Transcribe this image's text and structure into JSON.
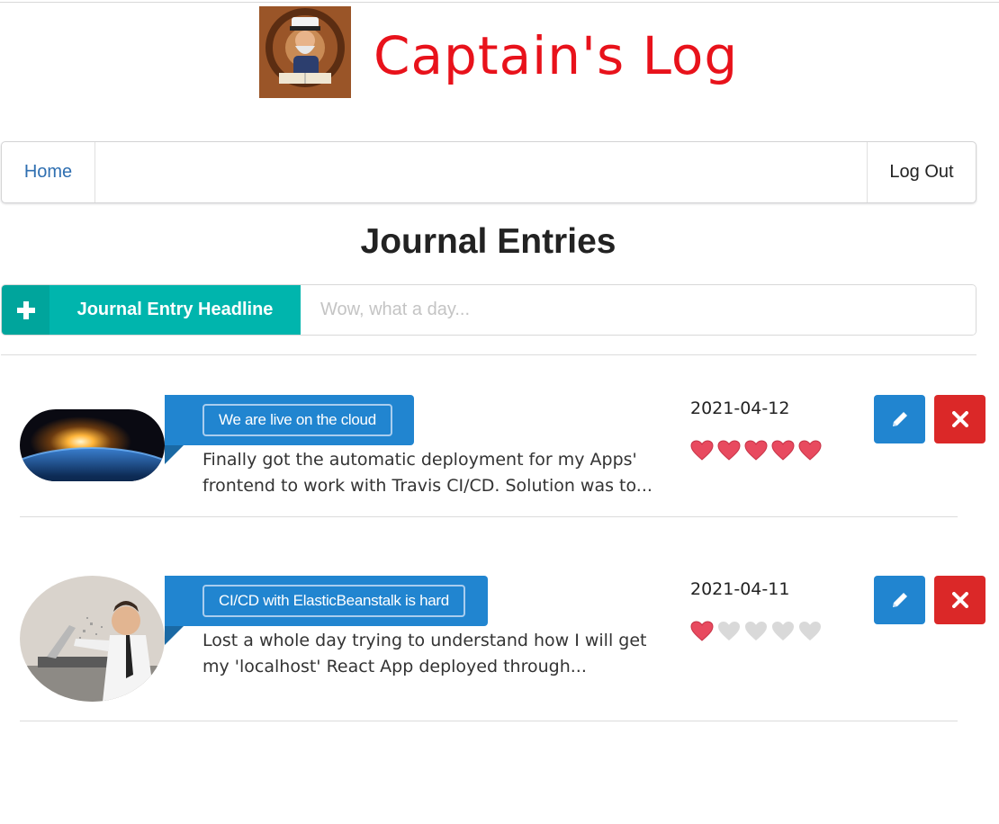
{
  "header": {
    "title": "Captain's Log",
    "logo": "captain-logo"
  },
  "nav": {
    "home_label": "Home",
    "logout_label": "Log Out"
  },
  "page": {
    "heading": "Journal Entries"
  },
  "new_entry": {
    "add_icon": "plus-icon",
    "headline_label": "Journal Entry Headline",
    "placeholder": "Wow, what a day...",
    "value": ""
  },
  "entries": [
    {
      "headline": "We are live on the cloud",
      "excerpt": "Finally got the automatic deployment for my Apps' frontend to work with Travis CI/CD. Solution was to...",
      "date": "2021-04-12",
      "rating": 5,
      "max_rating": 5,
      "image": "earth-sunrise"
    },
    {
      "headline": "CI/CD with ElasticBeanstalk is hard",
      "excerpt": "Lost a whole day trying to understand how I will get my 'localhost' React App deployed through...",
      "date": "2021-04-11",
      "rating": 1,
      "max_rating": 5,
      "image": "frustrated-laptop-man"
    }
  ],
  "colors": {
    "title": "#e8121b",
    "teal": "#00b5ad",
    "blue": "#2185d0",
    "red": "#db2828",
    "heart_on": "#e84a5f",
    "heart_off": "#d9d9d9"
  },
  "icons": {
    "edit": "pencil-icon",
    "delete": "close-icon",
    "rating": "heart-icon"
  }
}
